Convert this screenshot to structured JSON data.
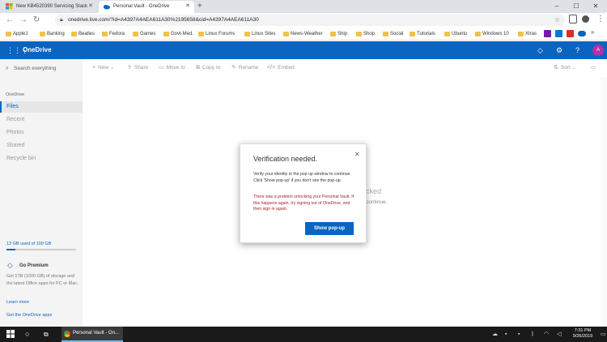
{
  "browser": {
    "tabs": [
      {
        "title": "New KB4520390 Servicing Stack"
      },
      {
        "title": "Personal Vault - OneDrive"
      }
    ],
    "new_tab": "+",
    "window_controls": {
      "minimize": "–",
      "maximize": "☐",
      "close": "✕"
    },
    "url": "onedrive.live.com/?id=A4397A4AEA611A30%2195658&cid=A4397A4AEA611A30",
    "bookmarks": [
      "Apple1",
      "Banking",
      "Beatles",
      "Fedora",
      "Games",
      "Govt-Med.",
      "Linux Forums",
      "Linux Sites",
      "News-Weather",
      "Ship",
      "Shop",
      "Social",
      "Tutorials",
      "Ubuntu",
      "Windows 10",
      "Xtras"
    ]
  },
  "header": {
    "app_title": "OneDrive",
    "avatar_initial": "A"
  },
  "sidebar": {
    "search_placeholder": "Search everything",
    "section_label": "OneDrive",
    "items": [
      {
        "label": "Files"
      },
      {
        "label": "Recent"
      },
      {
        "label": "Photos"
      },
      {
        "label": "Shared"
      },
      {
        "label": "Recycle bin"
      }
    ],
    "storage_text": "13 GB used of 100 GB",
    "storage_fraction": 0.13,
    "premium_title": "Go Premium",
    "premium_desc": "Get 1TB (1000 GB) of storage and the latest Office apps for PC or Mac.",
    "learn_more": "Learn more",
    "get_apps": "Get the OneDrive apps"
  },
  "commandbar": {
    "new": "New",
    "share": "Share",
    "move_to": "Move to",
    "copy_to": "Copy to",
    "rename": "Rename",
    "embed": "Embed",
    "sort": "Sort"
  },
  "background": {
    "line1": "cked",
    "line2": "continue."
  },
  "dialog": {
    "title": "Verification needed.",
    "close": "✕",
    "message": "Verify your identity in the pop up window to continue. Click 'Show pop-up' if you don't see the pop-up.",
    "error": "There was a problem unlocking your Personal Vault. If this happens again, try signing out of OneDrive, and then sign in again.",
    "button": "Show pop-up"
  },
  "taskbar": {
    "chrome_label": "Personal Vault - On...",
    "time": "7:31 PM",
    "date": "9/26/2019"
  },
  "colors": {
    "brand": "#0a64c0",
    "error": "#a4262c",
    "avatar": "#b52fa8"
  }
}
